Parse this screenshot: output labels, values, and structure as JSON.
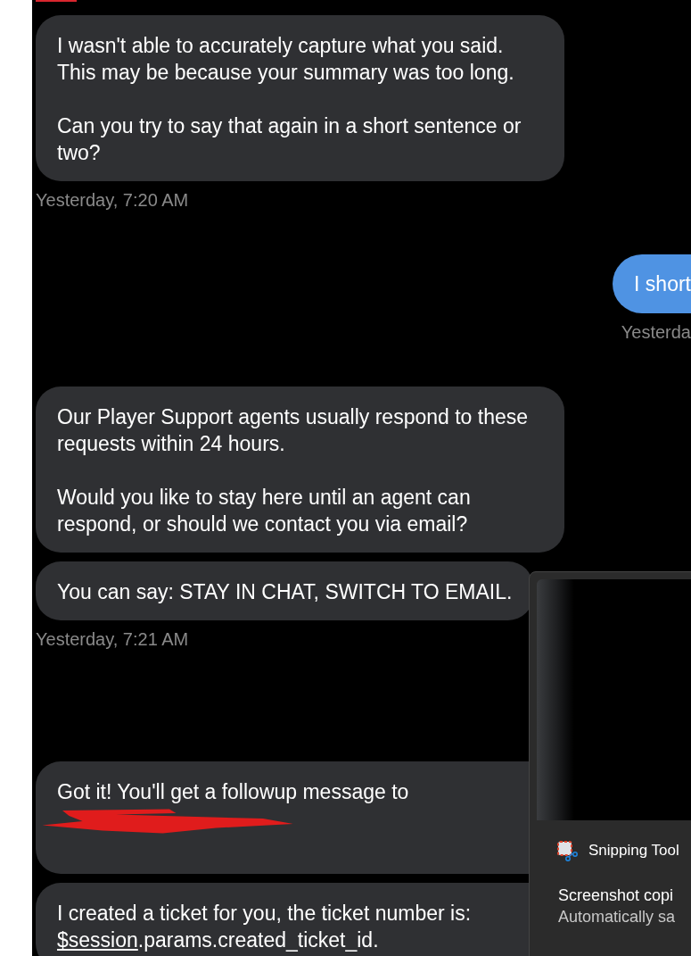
{
  "chat": {
    "groups": [
      {
        "items": [
          {
            "kind": "bot",
            "paragraphs": [
              "I wasn't able to accurately capture what you said. This may be because your summary was too long.",
              "Can you try to say that again in a short sentence or two?"
            ]
          },
          {
            "kind": "timestamp",
            "text": "Yesterday, 7:20 AM"
          },
          {
            "kind": "user",
            "paragraphs": [
              "I short"
            ]
          },
          {
            "kind": "user_timestamp",
            "text": "Yesterda"
          },
          {
            "kind": "bot",
            "paragraphs": [
              "Our Player Support agents usually respond to these requests within 24 hours.",
              "Would you like to stay here until an agent can respond, or should we contact you via email?"
            ]
          },
          {
            "kind": "bot",
            "paragraphs": [
              "You can say: STAY IN CHAT, SWITCH TO EMAIL."
            ]
          },
          {
            "kind": "timestamp",
            "text": "Yesterday, 7:21 AM"
          }
        ]
      },
      {
        "items": [
          {
            "kind": "bot_redacted",
            "paragraphs": [
              "Got it! You'll get a followup message to"
            ]
          },
          {
            "kind": "bot_link",
            "text": "I created a ticket for you, the ticket number is:",
            "link": "$session",
            "after": ".params.created_ticket_id."
          }
        ]
      }
    ]
  },
  "notification": {
    "app": "Snipping Tool",
    "lines": [
      "Screenshot copi",
      "Automatically sa"
    ]
  }
}
